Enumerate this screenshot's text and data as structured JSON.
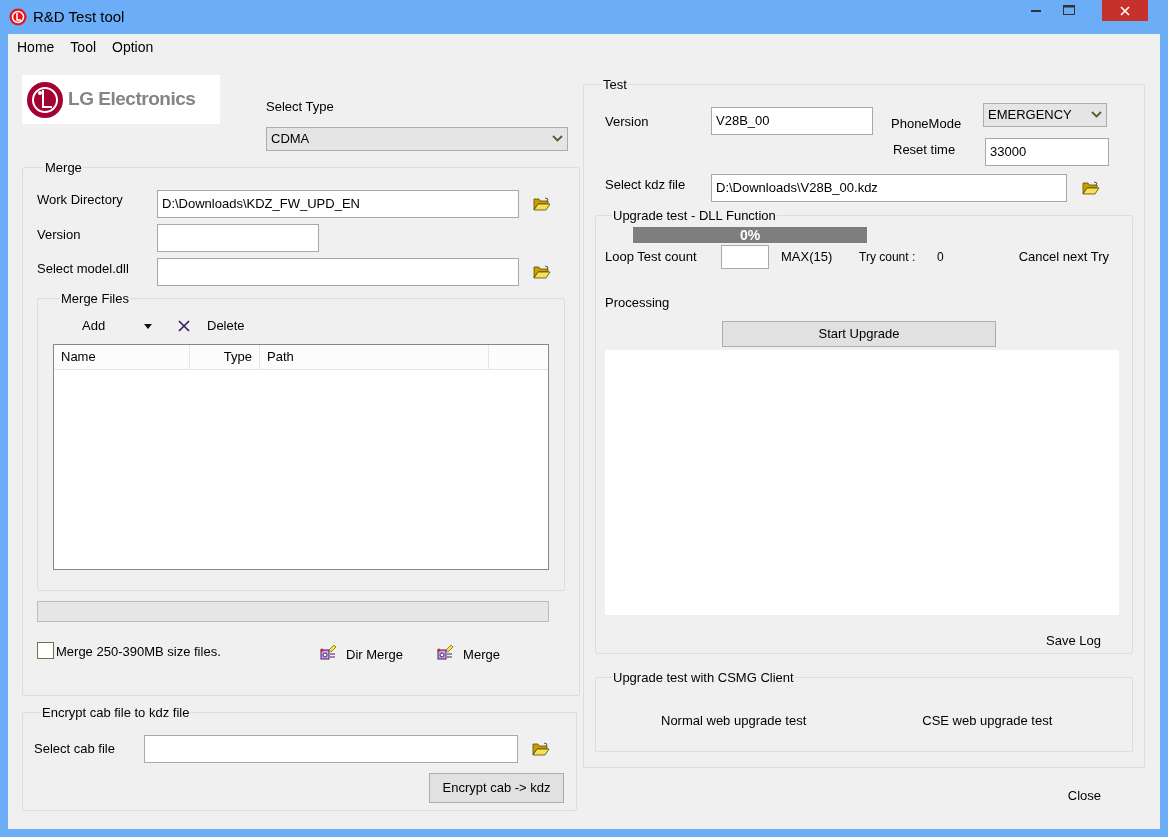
{
  "window": {
    "title": "R&D Test tool"
  },
  "menu": [
    {
      "label": "Home"
    },
    {
      "label": "Tool"
    },
    {
      "label": "Option"
    }
  ],
  "logo": {
    "text": "LG Electronics"
  },
  "select_type": {
    "label": "Select Type",
    "value": "CDMA"
  },
  "merge": {
    "title": "Merge",
    "work_directory": {
      "label": "Work Directory",
      "value": "D:\\Downloads\\KDZ_FW_UPD_EN"
    },
    "version": {
      "label": "Version"
    },
    "model_dll": {
      "label": "Select model.dll"
    },
    "files": {
      "title": "Merge Files",
      "add": "Add",
      "delete": "Delete",
      "columns": [
        "Name",
        "Type",
        "Path"
      ]
    },
    "progress": {
      "level": 0
    },
    "big_files": {
      "label": "Merge 250-390MB size files.",
      "checked": false
    },
    "buttons": [
      "Dir Merge",
      "Merge"
    ]
  },
  "encrypt": {
    "title": "Encrypt cab file to kdz file",
    "label": "Select cab file",
    "button": "Encrypt cab -> kdz"
  },
  "test": {
    "title": "Test",
    "version": {
      "label": "Version",
      "value": "V28B_00"
    },
    "phone_mode": {
      "label": "PhoneMode",
      "value": "EMERGENCY"
    },
    "reset_time": {
      "label": "Reset time",
      "value": "33000"
    },
    "kdz_file": {
      "label": "Select kdz file",
      "value": "D:\\Downloads\\V28B_00.kdz"
    },
    "dll": {
      "title": "Upgrade test - DLL Function",
      "progress": {
        "level": 0,
        "text": "0%"
      },
      "loop_label": "Loop Test count",
      "max_label": "MAX(15)",
      "try_label": "Try count :",
      "try_count": "0",
      "cancel": "Cancel next Try",
      "processing": "Processing",
      "start": "Start Upgrade",
      "save_log": "Save Log"
    },
    "csmg": {
      "title": "Upgrade test with CSMG Client",
      "buttons": [
        "Normal web upgrade test",
        "CSE web upgrade test"
      ]
    }
  },
  "close": "Close"
}
